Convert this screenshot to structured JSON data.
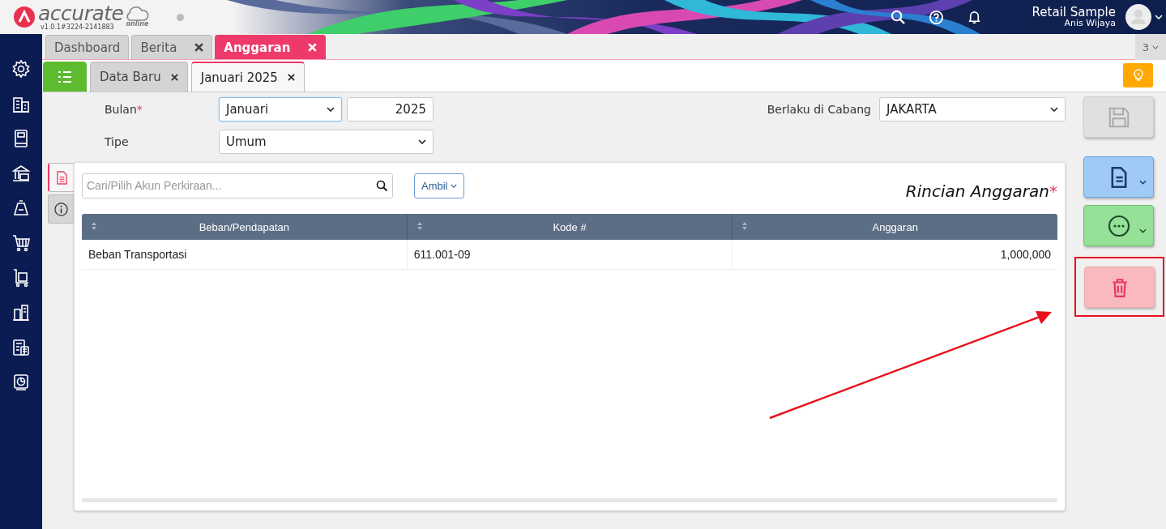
{
  "header": {
    "logo_text": "accurate",
    "logo_sub": "online",
    "version": "v1.0.1#3224-2141883",
    "company": "Retail Sample",
    "user": "Anis Wijaya"
  },
  "tabs": [
    {
      "label": "Dashboard",
      "selected": false,
      "closable": false
    },
    {
      "label": "Berita",
      "selected": false,
      "closable": true
    },
    {
      "label": "Anggaran",
      "selected": true,
      "closable": true
    }
  ],
  "tab_count": "3",
  "subtabs": [
    {
      "label": "Data Baru",
      "selected": false
    },
    {
      "label": "Januari 2025",
      "selected": true
    }
  ],
  "form": {
    "bulan_label": "Bulan",
    "bulan_mark": "*",
    "bulan_value": "Januari",
    "year_value": "2025",
    "tipe_label": "Tipe",
    "tipe_value": "Umum",
    "cabang_label": "Berlaku di Cabang",
    "cabang_value": "JAKARTA"
  },
  "side_tabs": [
    {
      "kind": "document",
      "selected": true
    },
    {
      "kind": "info",
      "selected": false
    }
  ],
  "panel": {
    "search_placeholder": "Cari/Pilih Akun Perkiraan...",
    "ambil_label": "Ambil",
    "title": "Rincian Anggaran",
    "title_mark": "*"
  },
  "table": {
    "columns": [
      "Beban/Pendapatan",
      "Kode #",
      "Anggaran"
    ],
    "rows": [
      [
        "Beban Transportasi",
        "611.001-09",
        "1,000,000"
      ]
    ]
  },
  "actions": [
    {
      "kind": "save",
      "disabled": true
    },
    {
      "kind": "document"
    },
    {
      "kind": "more"
    },
    {
      "kind": "delete",
      "highlighted": true
    }
  ]
}
